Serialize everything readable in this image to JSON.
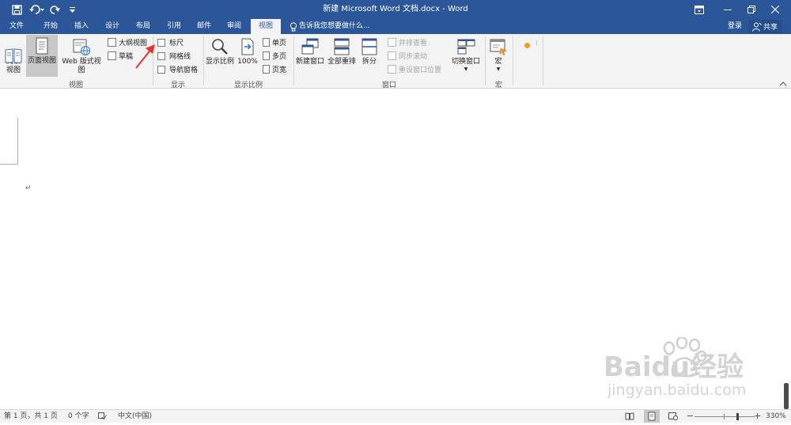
{
  "titlebar": {
    "title": "新建 Microsoft Word 文档.docx - Word",
    "qat": [
      "save-icon",
      "undo-icon",
      "redo-icon",
      "customize-icon"
    ],
    "window_buttons": [
      "ribbon-options-icon",
      "minimize-icon",
      "restore-icon",
      "close-icon"
    ]
  },
  "tabs": {
    "file": "文件",
    "home": "开始",
    "insert": "插入",
    "design": "设计",
    "layout": "布局",
    "references": "引用",
    "mailings": "邮件",
    "review": "审阅",
    "view": "视图",
    "tellme": "告诉我您想要做什么...",
    "signin": "登录",
    "share": "共享"
  },
  "ribbon": {
    "views": {
      "read_mode": "阅读\n视图",
      "print_layout": "页面视图",
      "web_layout": "Web 版式视图",
      "outline": "大纲视图",
      "draft": "草稿",
      "group_label": "视图"
    },
    "show": {
      "ruler": "标尺",
      "gridlines": "网格线",
      "nav_pane": "导航窗格",
      "group_label": "显示"
    },
    "zoom": {
      "zoom": "显示比例",
      "hundred": "100%",
      "one_page": "单页",
      "multi_page": "多页",
      "page_width": "页宽",
      "group_label": "显示比例"
    },
    "window": {
      "new_window": "新建窗口",
      "arrange_all": "全部重排",
      "split": "拆分",
      "side_by_side": "并排查看",
      "sync_scroll": "同步滚动",
      "reset_position": "重设窗口位置",
      "switch_windows": "切换窗口",
      "group_label": "窗口"
    },
    "macros": {
      "macros": "宏",
      "group_label": "宏"
    }
  },
  "document": {
    "paragraph_mark": "↵"
  },
  "watermark": {
    "brand": "Baidu经验",
    "url": "jingyan.baidu.com"
  },
  "statusbar": {
    "page": "第 1 页，共 1 页",
    "words": "0 个字",
    "language": "中文(中国)",
    "zoom": "330%"
  },
  "colors": {
    "accent": "#2b579a",
    "annotation_arrow": "#e8312f"
  }
}
